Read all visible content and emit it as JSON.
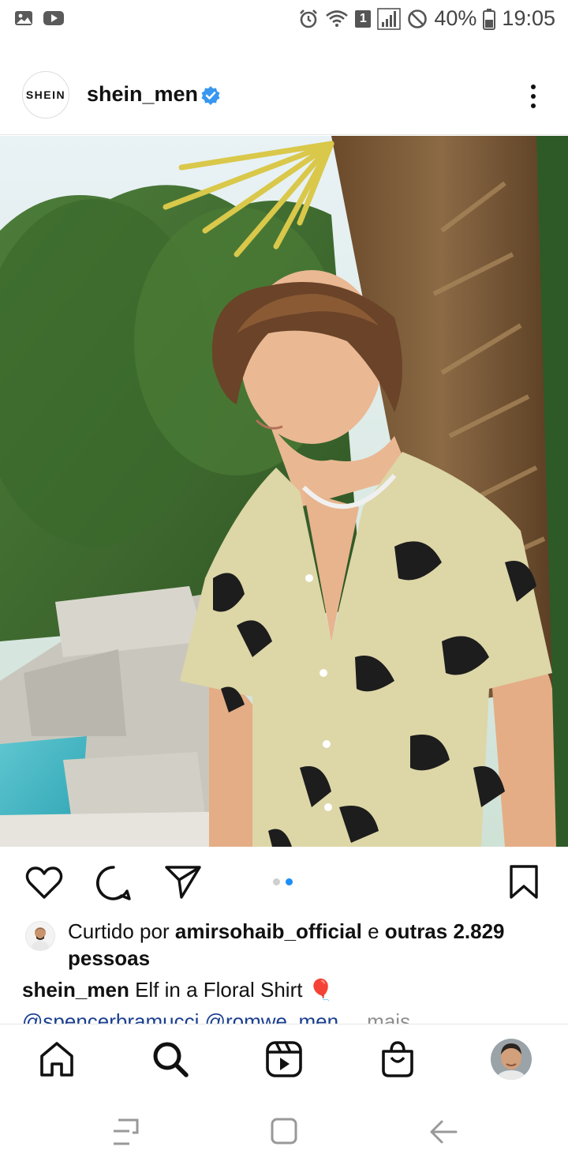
{
  "status_bar": {
    "battery": "40%",
    "time": "19:05",
    "sim_slot": "1",
    "left_icons": [
      "gallery-icon",
      "youtube-icon"
    ],
    "right_icons": [
      "alarm-icon",
      "wifi-icon",
      "signal-icon",
      "do-not-disturb-icon",
      "battery-icon"
    ]
  },
  "post": {
    "account_logo_text": "SHEIN",
    "username": "shein_men",
    "verified": true,
    "carousel": {
      "count": 2,
      "active": 2
    },
    "likes": {
      "prefix": "Curtido por",
      "liker": "amirsohaib_official",
      "connector": "e",
      "others": "outras 2.829 pessoas"
    },
    "caption": {
      "username": "shein_men",
      "text": "Elf in a Floral Shirt",
      "emoji": "🎈",
      "mentions": "@spencerbramucci @romwe_men",
      "more": "... mais"
    }
  },
  "colors": {
    "accent_blue": "#1b8ff5",
    "verified_blue": "#3897f0",
    "mention": "#1a3f8f",
    "muted": "#8e8e8e"
  },
  "bottom_nav": [
    "home-icon",
    "search-icon",
    "reels-icon",
    "shop-icon",
    "profile-avatar"
  ],
  "system_nav": [
    "recents-icon",
    "home-button-icon",
    "back-icon"
  ]
}
